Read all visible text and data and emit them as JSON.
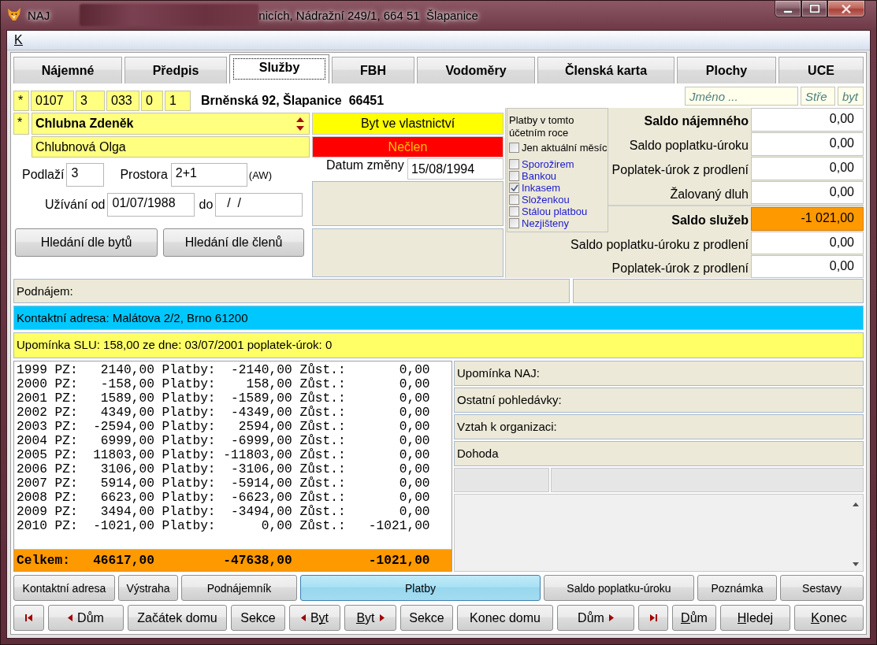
{
  "window": {
    "app_name": "NAJ",
    "title": "nicích, Nádražní 249/1, 664 51  Šlapanice"
  },
  "menu": [
    {
      "label": "K",
      "underline_first_letter": true
    }
  ],
  "tabs": [
    {
      "label": "Nájemné",
      "selected": false
    },
    {
      "label": "Předpis",
      "selected": false
    },
    {
      "label": "Služby",
      "selected": true
    },
    {
      "label": "FBH",
      "selected": false
    },
    {
      "label": "Vodoměry",
      "selected": false
    },
    {
      "label": "Členská karta",
      "selected": false
    },
    {
      "label": "Plochy",
      "selected": false
    },
    {
      "label": "UCE",
      "selected": false
    }
  ],
  "unit": {
    "marker": "*",
    "codes": [
      "0107",
      "3",
      "033",
      "0",
      "1"
    ],
    "address": "Brněnská 92, Šlapanice  66451"
  },
  "search": [
    {
      "placeholder": "Jméno ..."
    },
    {
      "placeholder": "Stře"
    },
    {
      "placeholder": "byt"
    }
  ],
  "tenants": {
    "marker": "*",
    "primary": "Chlubna Zdeněk",
    "secondary": "Chlubnová Olga"
  },
  "ownership": "Byt ve vlastnictví",
  "membership": "Nečlen",
  "floor": {
    "label": "Podlaží",
    "value": "3"
  },
  "space": {
    "label": "Prostora",
    "value": "2+1",
    "note": "(AW)"
  },
  "usage": {
    "label": "Užívání od",
    "from": "01/07/1988",
    "to_label": "do",
    "to": "/  /"
  },
  "change_date": {
    "label": "Datum změny",
    "value": "15/08/1994"
  },
  "search_buttons": [
    "Hledání dle bytů",
    "Hledání dle členů"
  ],
  "payment_filter": {
    "title": "Platby v tomto účetním roce",
    "options": [
      {
        "label": "Jen aktuální měsíc",
        "checked": false,
        "kind": "scope"
      },
      {
        "label": "Sporožirem",
        "checked": false,
        "kind": "method"
      },
      {
        "label": "Bankou",
        "checked": false,
        "kind": "method"
      },
      {
        "label": "Inkasem",
        "checked": true,
        "kind": "method"
      },
      {
        "label": "Složenkou",
        "checked": false,
        "kind": "method"
      },
      {
        "label": "Stálou platbou",
        "checked": false,
        "kind": "method"
      },
      {
        "label": "Nezjišteny",
        "checked": false,
        "kind": "method"
      }
    ]
  },
  "rent_balance": [
    {
      "label": "Saldo nájemného",
      "value": "0,00",
      "kind": "total",
      "highlight": false
    },
    {
      "label": "Saldo poplatku-úroku",
      "value": "0,00",
      "kind": "item",
      "highlight": false
    },
    {
      "label": "Poplatek-úrok z prodlení",
      "value": "0,00",
      "kind": "item",
      "highlight": false
    },
    {
      "label": "Žalovaný dluh",
      "value": "0,00",
      "kind": "item",
      "highlight": false
    }
  ],
  "service_balance": [
    {
      "label": "Saldo služeb",
      "value": "-1 021,00",
      "kind": "total",
      "highlight": true
    },
    {
      "label": "Saldo poplatku-úroku z prodlení",
      "value": "0,00",
      "kind": "item",
      "highlight": false
    },
    {
      "label": "Poplatek-úrok z prodlení",
      "value": "0,00",
      "kind": "item",
      "highlight": false
    }
  ],
  "sublease": {
    "label": "Podnájem:"
  },
  "contact": "Kontaktní adresa: Malátova 2/2, Brno 61200",
  "reminder": "Upomínka SLU: 158,00 ze dne: 03/07/2001 poplatek-úrok: 0",
  "ledger": {
    "lines": [
      "1999 PZ:   2140,00 Platby:  -2140,00 Zůst.:       0,00",
      "2000 PZ:   -158,00 Platby:    158,00 Zůst.:       0,00",
      "2001 PZ:   1589,00 Platby:  -1589,00 Zůst.:       0,00",
      "2002 PZ:   4349,00 Platby:  -4349,00 Zůst.:       0,00",
      "2003 PZ:  -2594,00 Platby:   2594,00 Zůst.:       0,00",
      "2004 PZ:   6999,00 Platby:  -6999,00 Zůst.:       0,00",
      "2005 PZ:  11803,00 Platby: -11803,00 Zůst.:       0,00",
      "2006 PZ:   3106,00 Platby:  -3106,00 Zůst.:       0,00",
      "2007 PZ:   5914,00 Platby:  -5914,00 Zůst.:       0,00",
      "2008 PZ:   6623,00 Platby:  -6623,00 Zůst.:       0,00",
      "2009 PZ:   3494,00 Platby:  -3494,00 Zůst.:       0,00",
      "2010 PZ:  -1021,00 Platby:      0,00 Zůst.:   -1021,00"
    ],
    "total": "Celkem:   46617,00         -47638,00          -1021,00"
  },
  "notes": [
    "Upomínka NAJ:",
    "Ostatní pohledávky:",
    "Vztah k organizaci:",
    "Dohoda"
  ],
  "actions": [
    {
      "label": "Kontaktní adresa",
      "selected": false
    },
    {
      "label": "Výstraha",
      "selected": false
    },
    {
      "label": "Podnájemník",
      "selected": false
    },
    {
      "label": "Platby",
      "selected": true
    },
    {
      "label": "Saldo poplatku-úroku",
      "selected": false
    },
    {
      "label": "Poznámka",
      "selected": false
    },
    {
      "label": "Sestavy",
      "selected": false
    }
  ],
  "navigation": [
    {
      "kind": "first"
    },
    {
      "kind": "prev",
      "label": "Dům",
      "underline_first_letter": false,
      "underline_second_letter": false
    },
    {
      "kind": "plain",
      "label": "Začátek domu",
      "underline_first_letter": false,
      "underline_second_letter": false
    },
    {
      "kind": "plain",
      "label": "Sekce",
      "underline_first_letter": false,
      "underline_second_letter": false
    },
    {
      "kind": "prev",
      "label": "Byt",
      "underline_first_letter": false,
      "underline_second_letter": true
    },
    {
      "kind": "next",
      "label": "Byt",
      "underline_first_letter": true,
      "underline_second_letter": false
    },
    {
      "kind": "plain",
      "label": "Sekce",
      "underline_first_letter": false,
      "underline_second_letter": false
    },
    {
      "kind": "plain",
      "label": "Konec domu",
      "underline_first_letter": false,
      "underline_second_letter": false
    },
    {
      "kind": "next",
      "label": "Dům",
      "underline_first_letter": false,
      "underline_second_letter": false
    },
    {
      "kind": "last"
    },
    {
      "kind": "plain",
      "label": "Dům",
      "underline_first_letter": true,
      "underline_second_letter": false
    },
    {
      "kind": "plain",
      "label": "Hledej",
      "underline_first_letter": true,
      "underline_second_letter": false
    },
    {
      "kind": "plain",
      "label": "Konec",
      "underline_first_letter": true,
      "underline_second_letter": false
    }
  ]
}
